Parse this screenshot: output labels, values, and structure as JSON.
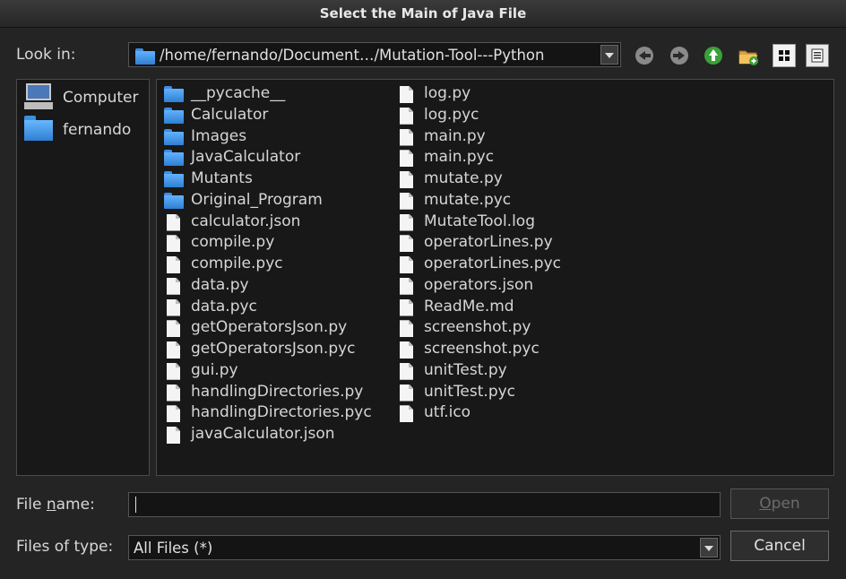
{
  "window": {
    "title": "Select the Main of Java File"
  },
  "lookin": {
    "label": "Look in:",
    "path": "/home/fernando/Document…/Mutation-Tool---Python"
  },
  "toolbar": {
    "back_icon": "back-arrow-icon",
    "forward_icon": "forward-arrow-icon",
    "parent_icon": "up-arrow-icon",
    "new_folder_icon": "new-folder-icon",
    "list_view_icon": "icon-view-icon",
    "detail_view_icon": "detail-view-icon"
  },
  "sidebar": {
    "items": [
      {
        "label": "Computer",
        "icon": "computer-icon"
      },
      {
        "label": "fernando",
        "icon": "folder-icon"
      }
    ]
  },
  "files": {
    "column1": [
      {
        "name": "__pycache__",
        "type": "folder"
      },
      {
        "name": "Calculator",
        "type": "folder"
      },
      {
        "name": "Images",
        "type": "folder"
      },
      {
        "name": "JavaCalculator",
        "type": "folder"
      },
      {
        "name": "Mutants",
        "type": "folder"
      },
      {
        "name": "Original_Program",
        "type": "folder"
      },
      {
        "name": "calculator.json",
        "type": "file"
      },
      {
        "name": "compile.py",
        "type": "file"
      },
      {
        "name": "compile.pyc",
        "type": "file"
      },
      {
        "name": "data.py",
        "type": "file"
      },
      {
        "name": "data.pyc",
        "type": "file"
      },
      {
        "name": "getOperatorsJson.py",
        "type": "file"
      },
      {
        "name": "getOperatorsJson.pyc",
        "type": "file"
      },
      {
        "name": "gui.py",
        "type": "file"
      },
      {
        "name": "handlingDirectories.py",
        "type": "file"
      },
      {
        "name": "handlingDirectories.pyc",
        "type": "file"
      },
      {
        "name": "javaCalculator.json",
        "type": "file"
      }
    ],
    "column2": [
      {
        "name": "log.py",
        "type": "file"
      },
      {
        "name": "log.pyc",
        "type": "file"
      },
      {
        "name": "main.py",
        "type": "file"
      },
      {
        "name": "main.pyc",
        "type": "file"
      },
      {
        "name": "mutate.py",
        "type": "file"
      },
      {
        "name": "mutate.pyc",
        "type": "file"
      },
      {
        "name": "MutateTool.log",
        "type": "file"
      },
      {
        "name": "operatorLines.py",
        "type": "file"
      },
      {
        "name": "operatorLines.pyc",
        "type": "file"
      },
      {
        "name": "operators.json",
        "type": "file"
      },
      {
        "name": "ReadMe.md",
        "type": "file"
      },
      {
        "name": "screenshot.py",
        "type": "file"
      },
      {
        "name": "screenshot.pyc",
        "type": "file"
      },
      {
        "name": "unitTest.py",
        "type": "file"
      },
      {
        "name": "unitTest.pyc",
        "type": "file"
      },
      {
        "name": "utf.ico",
        "type": "file"
      }
    ]
  },
  "filename": {
    "label_pre": "File ",
    "label_mnemonic": "n",
    "label_post": "ame:",
    "value": "",
    "placeholder": ""
  },
  "filetype": {
    "label": "Files of type:",
    "value": "All Files (*)"
  },
  "buttons": {
    "open_mnemonic": "O",
    "open_rest": "pen",
    "cancel": "Cancel"
  }
}
